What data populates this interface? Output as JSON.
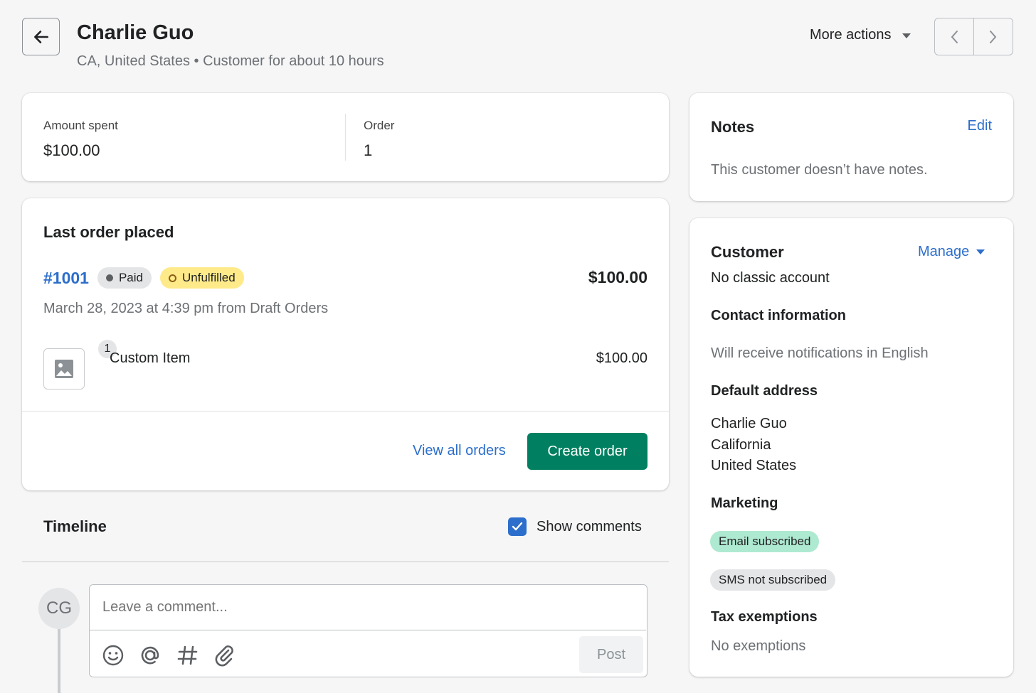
{
  "header": {
    "title": "Charlie Guo",
    "subtitle": "CA, United States • Customer for about 10 hours",
    "more_actions": "More actions"
  },
  "stats": {
    "amount_label": "Amount spent",
    "amount_value": "$100.00",
    "order_label": "Order",
    "order_value": "1"
  },
  "last_order": {
    "title": "Last order placed",
    "number": "#1001",
    "paid_badge": "Paid",
    "fulfillment_badge": "Unfulfilled",
    "total": "$100.00",
    "meta": "March 28, 2023 at 4:39 pm from Draft Orders",
    "item_qty": "1",
    "item_name": "Custom Item",
    "item_price": "$100.00",
    "view_all": "View all orders",
    "create_order": "Create order"
  },
  "timeline": {
    "title": "Timeline",
    "show_comments": "Show comments",
    "avatar_initials": "CG",
    "comment_placeholder": "Leave a comment...",
    "post": "Post"
  },
  "notes": {
    "title": "Notes",
    "edit": "Edit",
    "empty": "This customer doesn’t have notes."
  },
  "customer": {
    "title": "Customer",
    "manage": "Manage",
    "account": "No classic account",
    "contact_title": "Contact information",
    "contact_note": "Will receive notifications in English",
    "address_title": "Default address",
    "address_lines": [
      "Charlie Guo",
      "California",
      "United States"
    ],
    "marketing_title": "Marketing",
    "email_badge": "Email subscribed",
    "sms_badge": "SMS not subscribed",
    "tax_title": "Tax exemptions",
    "tax_value": "No exemptions"
  },
  "colors": {
    "accent": "#2c6ecb",
    "primary_button": "#008060",
    "email_badge_bg": "#aee9d1",
    "sms_badge_bg": "#e4e5e7",
    "unfulfilled_bg": "#ffea8a"
  }
}
